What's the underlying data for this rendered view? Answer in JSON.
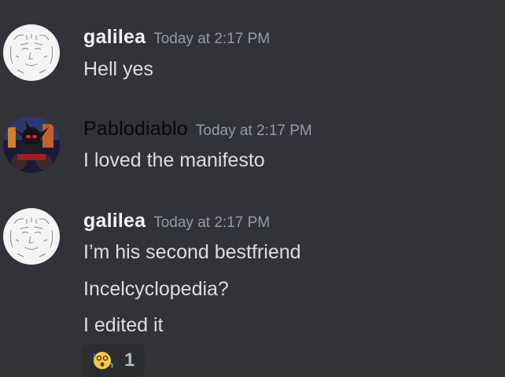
{
  "messages": [
    {
      "username": "galilea",
      "timestamp": "Today at 2:17 PM",
      "avatar": "sketch-face-avatar",
      "lines": [
        "Hell yes"
      ]
    },
    {
      "username": "Pablodiablo",
      "timestamp": "Today at 2:17 PM",
      "avatar": "hedgehog-character-avatar",
      "lines": [
        "I loved the manifesto"
      ]
    },
    {
      "username": "galilea",
      "timestamp": "Today at 2:17 PM",
      "avatar": "sketch-face-avatar",
      "lines": [
        "I’m his second bestfriend",
        "Incelcyclopedia?",
        "I edited it"
      ]
    }
  ],
  "reaction": {
    "emoji": "dizzy-face-emoji",
    "count": "1"
  },
  "colors": {
    "background": "#313338",
    "reaction_background": "#2b2d31",
    "timestamp": "#949ba4",
    "message_text": "#dbdee1"
  }
}
